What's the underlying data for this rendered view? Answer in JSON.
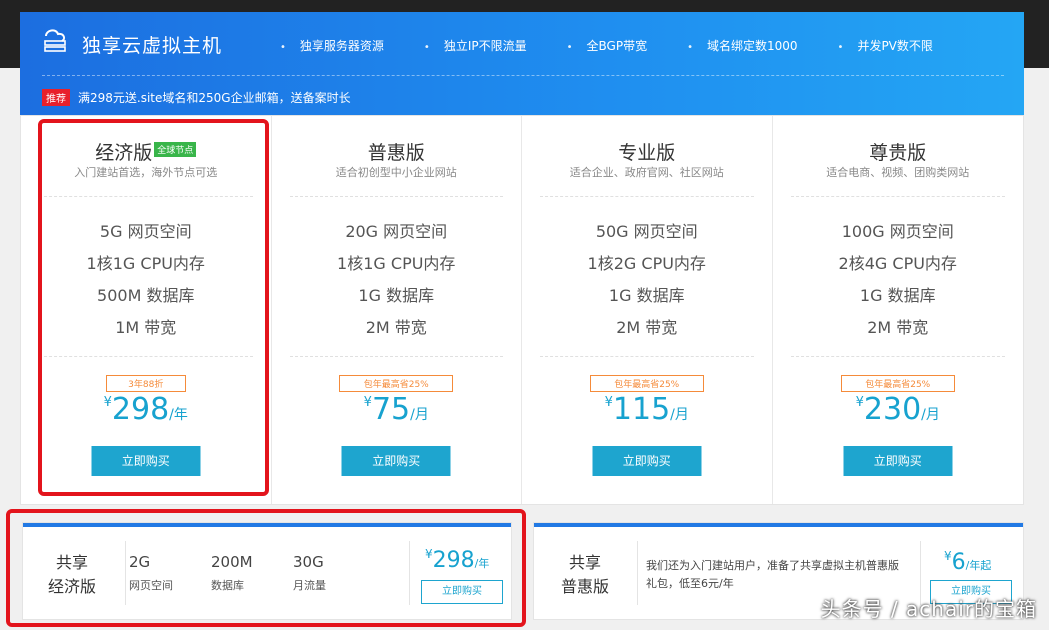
{
  "header": {
    "brand": "独享云虚拟主机",
    "features": [
      "独享服务器资源",
      "独立IP不限流量",
      "全BGP带宽",
      "域名绑定数1000",
      "并发PV数不限"
    ],
    "promo_tag": "推荐",
    "promo_text": "满298元送.site域名和250G企业邮箱，送备案时长"
  },
  "plans": [
    {
      "name": "经济版",
      "badge": "全球节点",
      "sub": "入门建站首选，海外节点可选",
      "specs": [
        "5G 网页空间",
        "1核1G CPU内存",
        "500M 数据库",
        "1M 带宽"
      ],
      "discount": "3年88折",
      "currency": "¥",
      "price": "298",
      "unit": "/年",
      "buy": "立即购买"
    },
    {
      "name": "普惠版",
      "badge": "",
      "sub": "适合初创型中小企业网站",
      "specs": [
        "20G 网页空间",
        "1核1G CPU内存",
        "1G 数据库",
        "2M 带宽"
      ],
      "discount": "包年最高省25%",
      "currency": "¥",
      "price": "75",
      "unit": "/月",
      "buy": "立即购买"
    },
    {
      "name": "专业版",
      "badge": "",
      "sub": "适合企业、政府官网、社区网站",
      "specs": [
        "50G 网页空间",
        "1核2G CPU内存",
        "1G 数据库",
        "2M 带宽"
      ],
      "discount": "包年最高省25%",
      "currency": "¥",
      "price": "115",
      "unit": "/月",
      "buy": "立即购买"
    },
    {
      "name": "尊贵版",
      "badge": "",
      "sub": "适合电商、视频、团购类网站",
      "specs": [
        "100G 网页空间",
        "2核4G CPU内存",
        "1G 数据库",
        "2M 带宽"
      ],
      "discount": "包年最高省25%",
      "currency": "¥",
      "price": "230",
      "unit": "/月",
      "buy": "立即购买"
    }
  ],
  "shared_econ": {
    "name_line1": "共享",
    "name_line2": "经济版",
    "stats": [
      {
        "value": "2G",
        "label": "网页空间"
      },
      {
        "value": "200M",
        "label": "数据库"
      },
      {
        "value": "30G",
        "label": "月流量"
      }
    ],
    "currency": "¥",
    "price": "298",
    "unit": "/年",
    "buy": "立即购买"
  },
  "shared_puhui": {
    "name_line1": "共享",
    "name_line2": "普惠版",
    "desc": "我们还为入门建站用户，准备了共享虚拟主机普惠版礼包，低至6元/年",
    "currency": "¥",
    "price": "6",
    "unit": "/年起",
    "buy": "立即购买"
  },
  "watermark": "头条号 / achair的宝箱",
  "colors": {
    "accent": "#1ea5cf",
    "price": "#17a2cf",
    "highlight": "#e3141c",
    "badge": "#39b54a",
    "discount": "#f58b3a"
  }
}
